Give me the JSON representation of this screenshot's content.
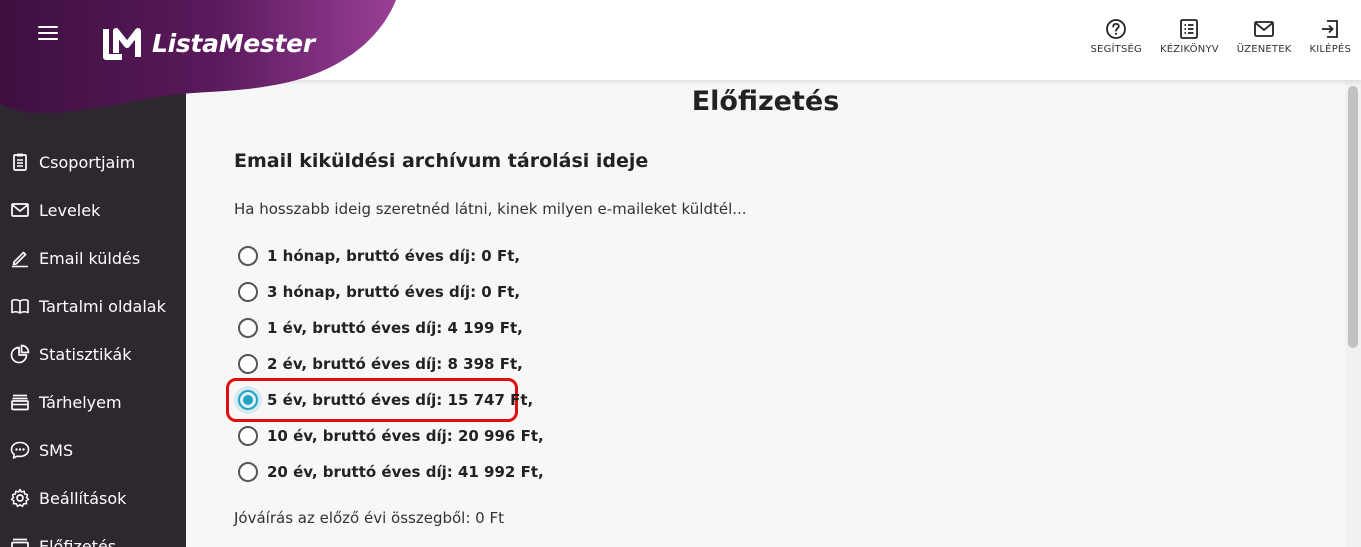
{
  "brand": {
    "name": "ListaMester",
    "primary_color": "#4b1450",
    "accent_color": "#21a4c4",
    "highlight_color": "#e10c0c"
  },
  "header": {
    "actions": [
      {
        "label": "SEGÍTSÉG",
        "icon": "help-circle-icon"
      },
      {
        "label": "KÉZIKÖNYV",
        "icon": "manual-icon"
      },
      {
        "label": "ÜZENETEK",
        "icon": "mail-icon"
      },
      {
        "label": "KILÉPÉS",
        "icon": "logout-icon"
      }
    ]
  },
  "sidebar": {
    "items": [
      {
        "label": "Csoportjaim",
        "icon": "clipboard-icon"
      },
      {
        "label": "Levelek",
        "icon": "envelope-icon"
      },
      {
        "label": "Email küldés",
        "icon": "pencil-icon"
      },
      {
        "label": "Tartalmi oldalak",
        "icon": "book-icon"
      },
      {
        "label": "Statisztikák",
        "icon": "pie-chart-icon"
      },
      {
        "label": "Tárhelyem",
        "icon": "storage-icon"
      },
      {
        "label": "SMS",
        "icon": "chat-bubble-icon"
      },
      {
        "label": "Beállítások",
        "icon": "gear-icon"
      },
      {
        "label": "Előfizetés",
        "icon": "subscription-icon"
      }
    ]
  },
  "main": {
    "title": "Előfizetés",
    "section_title": "Email kiküldési archívum tárolási ideje",
    "description": "Ha hosszabb ideig szeretnéd látni, kinek milyen e-maileket küldtél...",
    "options": [
      {
        "label": "1 hónap, bruttó éves díj: 0 Ft,",
        "selected": false
      },
      {
        "label": "3 hónap, bruttó éves díj: 0 Ft,",
        "selected": false
      },
      {
        "label": "1 év, bruttó éves díj: 4 199 Ft,",
        "selected": false
      },
      {
        "label": "2 év, bruttó éves díj: 8 398 Ft,",
        "selected": false
      },
      {
        "label": "5 év, bruttó éves díj: 15 747 Ft,",
        "selected": true
      },
      {
        "label": "10 év, bruttó éves díj: 20 996 Ft,",
        "selected": false
      },
      {
        "label": "20 év, bruttó éves díj: 41 992 Ft,",
        "selected": false
      }
    ],
    "credit_text": "Jóváírás az előző évi összegből: 0 Ft"
  }
}
